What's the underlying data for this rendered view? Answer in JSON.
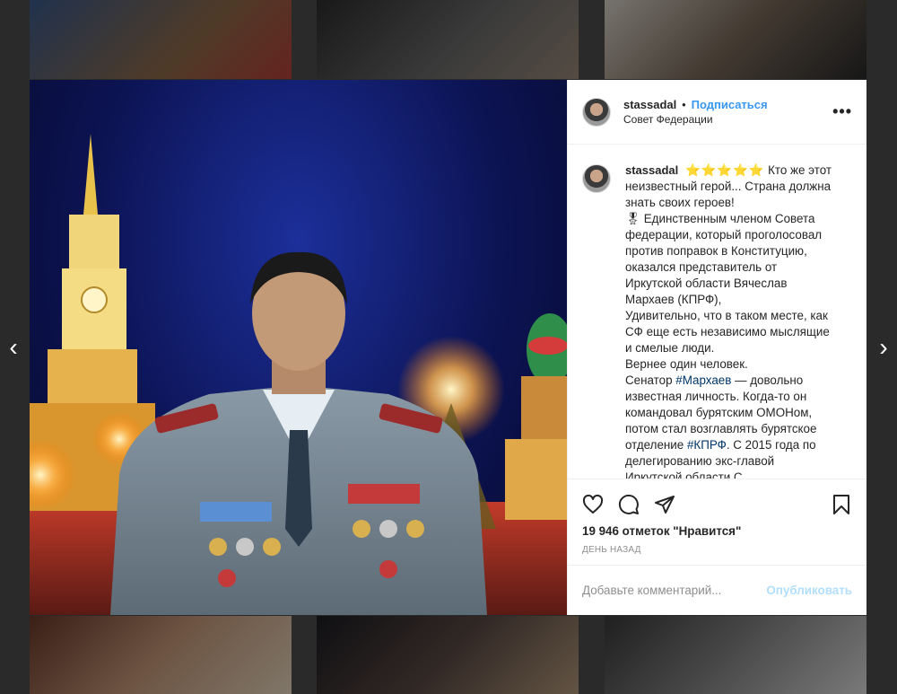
{
  "post": {
    "username": "stassadal",
    "separator": "•",
    "follow_label": "Подписаться",
    "location": "Совет Федерации",
    "more_label": "•••",
    "caption": {
      "stars": "⭐⭐⭐⭐⭐",
      "lines": [
        "Кто же этот",
        "неизвестный герой... Страна должна",
        "знать своих героев!",
        "🎖 Единственным членом Совета",
        "федерации, который проголосовал",
        "против поправок в Конституцию,",
        "оказался представитель от",
        "Иркутской области Вячеслав",
        "Мархаев (КПРФ),",
        "Удивительно, что в таком месте, как",
        "СФ еще есть независимо мыслящие",
        "и смелые люди.",
        "Вернее один человек.",
        "Сенатор",
        "— довольно",
        "известная личность. Когда-то он",
        "командовал бурятским ОМОНом,",
        "потом стал возглавлять бурятское",
        "отделение",
        ". С 2015 года по",
        "делегированию экс-главой",
        "Иркутской области С..."
      ],
      "hashtags": [
        "#Мархаев",
        "#КПРФ"
      ]
    },
    "likes": "19 946 отметок \"Нравится\"",
    "timestamp": "ДЕНЬ НАЗАД",
    "comment_placeholder": "Добавьте комментарий...",
    "publish_label": "Опубликовать"
  },
  "nav": {
    "prev": "‹",
    "next": "›"
  },
  "colors": {
    "link": "#3897f0",
    "hashtag": "#003569",
    "publish_disabled": "#b2dffc",
    "stars": "#f3b41f"
  }
}
